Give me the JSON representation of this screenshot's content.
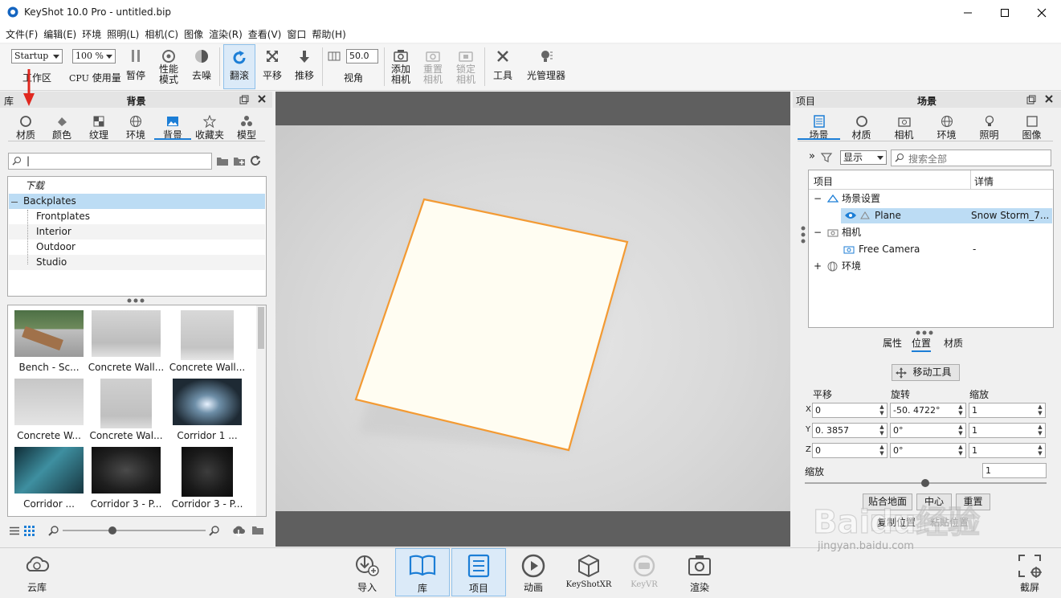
{
  "window": {
    "title": "KeyShot 10.0 Pro  - untitled.bip"
  },
  "menu": [
    "文件(F)",
    "编辑(E)",
    "环境",
    "照明(L)",
    "相机(C)",
    "图像",
    "渲染(R)",
    "查看(V)",
    "窗口",
    "帮助(H)"
  ],
  "toolbar": {
    "workspace_value": "Startup",
    "workspace_label": "工作区",
    "cpu_value": "100 %",
    "cpu_label_prefix": "CPU",
    "cpu_label": "使用量",
    "pause": "暂停",
    "perf_mode": "性能\n模式",
    "denoise": "去噪",
    "tumble": "翻滚",
    "pan": "平移",
    "dolly": "推移",
    "fov_value": "50.0",
    "fov": "视角",
    "add_camera": "添加\n相机",
    "reset_camera": "重置\n相机",
    "lock_camera": "锁定\n相机",
    "tools": "工具",
    "light_manager": "光管理器"
  },
  "library": {
    "header_left": "库",
    "header_title": "背景",
    "tabs": [
      "材质",
      "颜色",
      "纹理",
      "环境",
      "背景",
      "收藏夹",
      "模型"
    ],
    "active_tab": "背景",
    "search_value": "|",
    "tree": [
      {
        "label": "下载",
        "italic": true,
        "indent": 0
      },
      {
        "label": "Backplates",
        "selected": true,
        "indent": 0
      },
      {
        "label": "Frontplates",
        "indent": 1
      },
      {
        "label": "Interior",
        "indent": 1
      },
      {
        "label": "Outdoor",
        "indent": 1
      },
      {
        "label": "Studio",
        "indent": 1
      }
    ],
    "thumbs": [
      "Bench - Sc...",
      "Concrete Wall...",
      "Concrete Wall...",
      "Concrete W...",
      "Concrete Wal...",
      "Corridor 1 ...",
      "Corridor ...",
      "Corridor 3 - P...",
      "Corridor 3 - P..."
    ]
  },
  "project": {
    "header_left": "项目",
    "header_title": "场景",
    "tabs": [
      "场景",
      "材质",
      "相机",
      "环境",
      "照明",
      "图像"
    ],
    "active_tab": "场景",
    "display_value": "显示",
    "search_placeholder": "搜索全部",
    "col_item": "项目",
    "col_detail": "详情",
    "tree": [
      {
        "label": "场景设置",
        "detail": "",
        "indent": 0
      },
      {
        "label": "Plane",
        "detail": "Snow Storm_7...",
        "indent": 1,
        "selected": true
      },
      {
        "label": "相机",
        "detail": "",
        "indent": 0
      },
      {
        "label": "Free Camera",
        "detail": "-",
        "indent": 1
      },
      {
        "label": "环境",
        "detail": "",
        "indent": 0
      }
    ],
    "subtabs": [
      "属性",
      "位置",
      "材质"
    ],
    "active_subtab": "位置",
    "move_tool": "移动工具",
    "translate": "平移",
    "rotate": "旋转",
    "scale": "缩放",
    "rows": [
      {
        "axis": "X",
        "t": "0",
        "r": "-50. 4722°",
        "s": "1"
      },
      {
        "axis": "Y",
        "t": "0. 3857",
        "r": "0°",
        "s": "1"
      },
      {
        "axis": "Z",
        "t": "0",
        "r": "0°",
        "s": "1"
      }
    ],
    "uniform_scale_label": "缩放",
    "uniform_scale_value": "1",
    "snap_ground": "贴合地面",
    "center": "中心",
    "reset": "重置",
    "copy_pos": "复制位置",
    "paste_pos": "粘贴位置"
  },
  "bottom": {
    "cloud": "云库",
    "import": "导入",
    "library": "库",
    "project": "项目",
    "animation": "动画",
    "keyshotxr": "KeyShotXR",
    "keyvr": "KeyVR",
    "render": "渲染",
    "screenshot": "截屏"
  },
  "watermark": {
    "brand": "Baidu经验",
    "url": "jingyan.baidu.com"
  },
  "colors": {
    "accent": "#1c7ed6",
    "selected_row": "#bcdcf4",
    "plane_edge": "#f39a33",
    "annotation_arrow": "#e0281f"
  }
}
